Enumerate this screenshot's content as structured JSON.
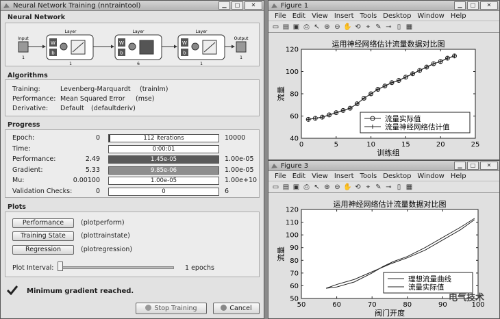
{
  "nntool": {
    "title": "Neural Network Training (nntraintool)",
    "network_section": "Neural Network",
    "diagram": {
      "input_label": "Input",
      "output_label": "Output",
      "input_size": "1",
      "output_size": "1",
      "layers": [
        {
          "label": "Layer",
          "size": "1"
        },
        {
          "label": "Layer",
          "size": "6"
        },
        {
          "label": "Layer",
          "size": "1"
        }
      ],
      "w_label": "W",
      "b_label": "b"
    },
    "algorithms_section": "Algorithms",
    "algorithms": [
      {
        "label": "Training:",
        "value": "Levenberg-Marquardt",
        "fn": "(trainlm)"
      },
      {
        "label": "Performance:",
        "value": "Mean Squared Error",
        "fn": "(mse)"
      },
      {
        "label": "Derivative:",
        "value": "Default",
        "fn": "(defaultderiv)"
      }
    ],
    "progress_section": "Progress",
    "progress": [
      {
        "label": "Epoch:",
        "min": "0",
        "text": "112 iterations",
        "max": "10000",
        "fill": 0.01,
        "color": "#3a3a3a"
      },
      {
        "label": "Time:",
        "min": "",
        "text": "0:00:01",
        "max": "",
        "fill": 0,
        "color": "#ffffff"
      },
      {
        "label": "Performance:",
        "min": "2.49",
        "text": "1.45e-05",
        "max": "1.00e-05",
        "fill": 1.0,
        "color": "#5a5a5a"
      },
      {
        "label": "Gradient:",
        "min": "5.33",
        "text": "9.85e-06",
        "max": "1.00e-05",
        "fill": 1.0,
        "color": "#8e8e8e"
      },
      {
        "label": "Mu:",
        "min": "0.00100",
        "text": "1.00e-05",
        "max": "1.00e+10",
        "fill": 0,
        "color": "#ffffff"
      },
      {
        "label": "Validation Checks:",
        "min": "0",
        "text": "0",
        "max": "6",
        "fill": 0,
        "color": "#ffffff"
      }
    ],
    "plots_section": "Plots",
    "plot_buttons": [
      {
        "label": "Performance",
        "fn": "(plotperform)"
      },
      {
        "label": "Training State",
        "fn": "(plottrainstate)"
      },
      {
        "label": "Regression",
        "fn": "(plotregression)"
      }
    ],
    "plot_interval_label": "Plot Interval:",
    "plot_interval_value": "1 epochs",
    "status_message": "Minimum gradient reached.",
    "stop_button": "Stop Training",
    "cancel_button": "Cancel"
  },
  "figure1": {
    "title": "Figure 1",
    "menu": [
      "File",
      "Edit",
      "View",
      "Insert",
      "Tools",
      "Desktop",
      "Window",
      "Help"
    ]
  },
  "figure3": {
    "title": "Figure 3",
    "menu": [
      "File",
      "Edit",
      "View",
      "Insert",
      "Tools",
      "Desktop",
      "Window",
      "Help"
    ]
  },
  "watermark": "电气技术",
  "chart_data": [
    {
      "type": "line",
      "title": "运用神经网络估计流量数据对比图",
      "xlabel": "训练组",
      "ylabel": "流量",
      "xlim": [
        0,
        25
      ],
      "ylim": [
        40,
        120
      ],
      "xticks": [
        0,
        5,
        10,
        15,
        20,
        25
      ],
      "yticks": [
        40,
        60,
        80,
        100,
        120
      ],
      "legend_position": "bottom-right",
      "series": [
        {
          "name": "流量实际值",
          "marker": "circle",
          "x": [
            1,
            2,
            3,
            4,
            5,
            6,
            7,
            8,
            9,
            10,
            11,
            12,
            13,
            14,
            15,
            16,
            17,
            18,
            19,
            20,
            21,
            22
          ],
          "y": [
            57,
            58,
            59,
            61,
            63,
            65,
            67,
            71,
            76,
            80,
            84,
            87,
            90,
            92,
            95,
            98,
            101,
            104,
            107,
            109,
            112,
            114
          ]
        },
        {
          "name": "流量神经网络估计值",
          "marker": "plus",
          "x": [
            1,
            2,
            3,
            4,
            5,
            6,
            7,
            8,
            9,
            10,
            11,
            12,
            13,
            14,
            15,
            16,
            17,
            18,
            19,
            20,
            21,
            22
          ],
          "y": [
            57,
            58,
            59,
            61,
            63,
            65,
            67,
            71,
            76,
            80,
            84,
            87,
            90,
            92,
            95,
            98,
            101,
            104,
            107,
            109,
            112,
            114
          ]
        }
      ]
    },
    {
      "type": "line",
      "title": "运用神经网络估计流量数据对比图",
      "xlabel": "阀门开度",
      "ylabel": "流量",
      "xlim": [
        50,
        100
      ],
      "ylim": [
        50,
        120
      ],
      "xticks": [
        50,
        60,
        70,
        80,
        90,
        100
      ],
      "yticks": [
        50,
        60,
        70,
        80,
        90,
        100,
        110,
        120
      ],
      "legend_position": "bottom-right",
      "series": [
        {
          "name": "理想流量曲线",
          "x": [
            57,
            60,
            65,
            70,
            75,
            80,
            85,
            90,
            95,
            99
          ],
          "y": [
            58,
            61,
            65,
            71,
            77,
            82,
            88,
            96,
            104,
            112
          ]
        },
        {
          "name": "流量实际值",
          "x": [
            57,
            60,
            65,
            70,
            73,
            76,
            80,
            85,
            90,
            95,
            99
          ],
          "y": [
            58,
            59,
            63,
            70,
            75,
            79,
            83,
            90,
            98,
            106,
            113
          ]
        }
      ]
    }
  ]
}
